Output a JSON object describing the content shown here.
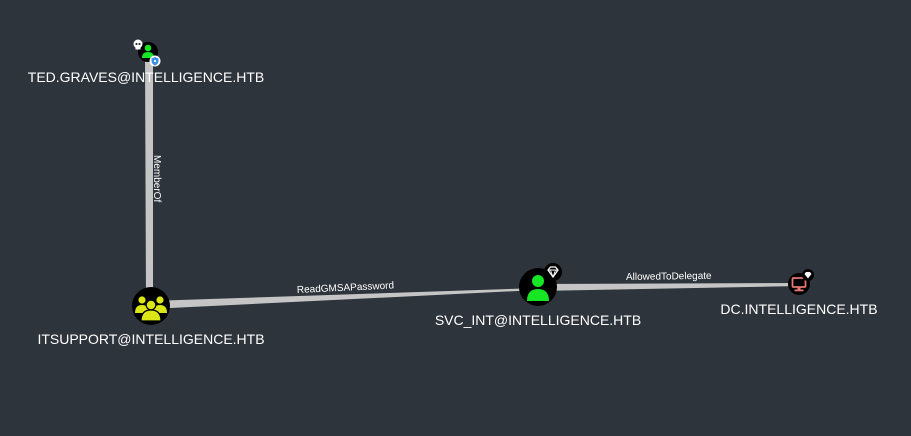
{
  "nodes": {
    "ted": {
      "label": "TED.GRAVES@INTELLIGENCE.HTB",
      "type": "user",
      "icon": "user-icon",
      "badges": [
        "skull-icon",
        "shield-icon"
      ]
    },
    "itsupport": {
      "label": "ITSUPPORT@INTELLIGENCE.HTB",
      "type": "group",
      "icon": "group-icon"
    },
    "svc": {
      "label": "SVC_INT@INTELLIGENCE.HTB",
      "type": "user",
      "icon": "user-icon",
      "badges": [
        "diamond-icon"
      ]
    },
    "dc": {
      "label": "DC.INTELLIGENCE.HTB",
      "type": "computer",
      "icon": "computer-icon",
      "badges": [
        "diamond-icon"
      ]
    }
  },
  "edges": {
    "memberof": {
      "label": "MemberOf",
      "from": "ted",
      "to": "itsupport"
    },
    "readgmsa": {
      "label": "ReadGMSAPassword",
      "from": "itsupport",
      "to": "svc"
    },
    "delegate": {
      "label": "AllowedToDelegate",
      "from": "svc",
      "to": "dc"
    }
  },
  "colors": {
    "background": "#2e343b",
    "edge": "#c5c5c5",
    "user": "#17e625",
    "group": "#dbe617",
    "computer": "#e67873",
    "badge_shield": "#3a8ee6"
  }
}
